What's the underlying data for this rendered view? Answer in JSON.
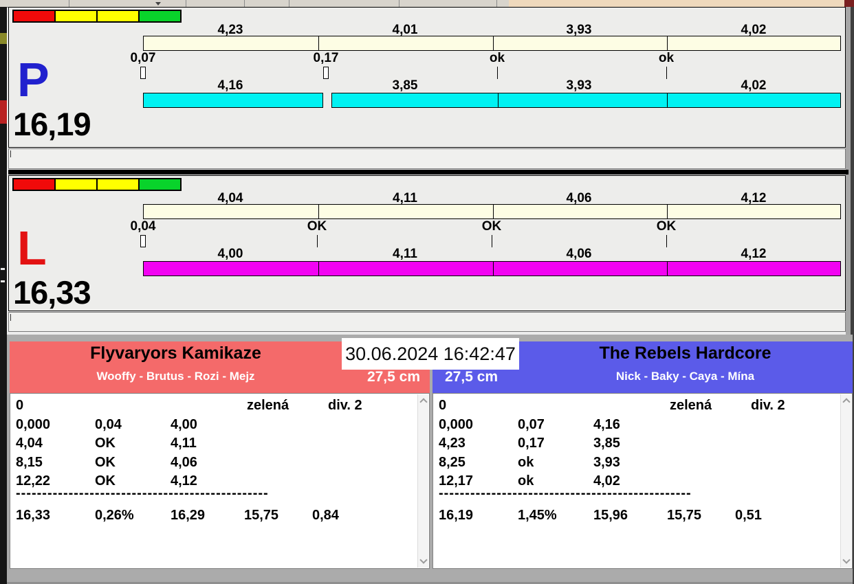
{
  "datetime": "30.06.2024 16:42:47",
  "colors": {
    "lane_p_letter": "#2121CE",
    "lane_l_letter": "#E31212",
    "split_bar": "#FDFDE4",
    "p_run_bar": "#00F2F2",
    "l_run_bar": "#F203F2",
    "team_left_header": "#F46A6A",
    "team_right_header": "#5B5BE9",
    "traffic_red": "#F10A0A",
    "traffic_yellow": "#FFFF00",
    "traffic_green": "#09D32B"
  },
  "lanes": [
    {
      "label": "P",
      "total": "16,19",
      "splits": [
        "4,23",
        "4,01",
        "3,93",
        "4,02"
      ],
      "markers": [
        "0,07",
        "0,17",
        "ok",
        "ok"
      ],
      "run_times": [
        "4,16",
        "3,85",
        "3,93",
        "4,02"
      ]
    },
    {
      "label": "L",
      "total": "16,33",
      "splits": [
        "4,04",
        "4,11",
        "4,06",
        "4,12"
      ],
      "markers": [
        "0,04",
        "OK",
        "OK",
        "OK"
      ],
      "run_times": [
        "4,00",
        "4,11",
        "4,06",
        "4,12"
      ]
    }
  ],
  "teams": [
    {
      "name": "Flyvaryors Kamikaze",
      "dogs": "Wooffy - Brutus - Rozi - Mejz",
      "height": "27,5 cm",
      "row0": {
        "c1": "0",
        "status": "zelená",
        "division": "div. 2"
      },
      "rows": [
        [
          "0,000",
          "0,04",
          "4,00"
        ],
        [
          "4,04",
          "OK",
          "4,11"
        ],
        [
          "8,15",
          "OK",
          "4,06"
        ],
        [
          "12,22",
          "OK",
          "4,12"
        ]
      ],
      "separator": "------------------------------------------------",
      "totals": [
        "16,33",
        "0,26%",
        "16,29",
        "15,75",
        "0,84"
      ]
    },
    {
      "name": "The Rebels Hardcore",
      "dogs": "Nick - Baky - Caya - Mína",
      "height": "27,5 cm",
      "row0": {
        "c1": "0",
        "status": "zelená",
        "division": "div. 2"
      },
      "rows": [
        [
          "0,000",
          "0,07",
          "4,16"
        ],
        [
          "4,23",
          "0,17",
          "3,85"
        ],
        [
          "8,25",
          "ok",
          "3,93"
        ],
        [
          "12,17",
          "ok",
          "4,02"
        ]
      ],
      "separator": "------------------------------------------------",
      "totals": [
        "16,19",
        "1,45%",
        "15,96",
        "15,75",
        "0,51"
      ]
    }
  ]
}
